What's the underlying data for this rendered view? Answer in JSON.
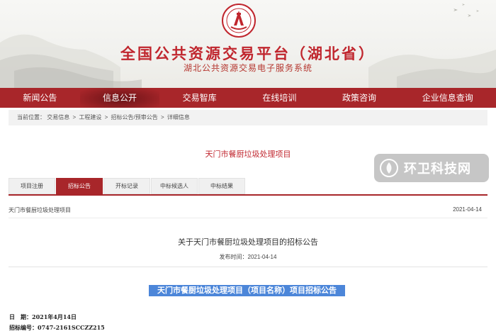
{
  "header": {
    "title": "全国公共资源交易平台（湖北省）",
    "subtitle": "湖北公共资源交易电子服务系统",
    "emblem_icon": "public-resource-emblem",
    "colors": {
      "brand_red": "#a8262a",
      "title_red": "#c0262e"
    }
  },
  "nav": {
    "items": [
      {
        "label": "新闻公告"
      },
      {
        "label": "信息公开"
      },
      {
        "label": "交易智库"
      },
      {
        "label": "在线培训"
      },
      {
        "label": "政策咨询"
      },
      {
        "label": "企业信息查询"
      }
    ],
    "active_index": 1
  },
  "breadcrumb": {
    "prefix": "当前位置：",
    "items": [
      "交易信息",
      "工程建设",
      "招标公告/预审公告",
      "详细信息"
    ],
    "separator": ">"
  },
  "project_title": "天门市餐厨垃圾处理项目",
  "tabs": {
    "items": [
      {
        "label": "项目注册"
      },
      {
        "label": "招标公告"
      },
      {
        "label": "开标记录"
      },
      {
        "label": "中标候选人"
      },
      {
        "label": "中标结果"
      }
    ],
    "active_index": 1
  },
  "list_row": {
    "name": "天门市餐厨垃圾处理项目",
    "date": "2021-04-14"
  },
  "notice": {
    "title": "关于天门市餐厨垃圾处理项目的招标公告",
    "publish_label": "发布时间：2021-04-14",
    "highlight_heading": "天门市餐厨垃圾处理项目（项目名称）项目招标公告",
    "date_line": "日　期：2021年4月14日",
    "code_line": "招标编号：0747-2161SCCZZ215"
  },
  "watermark": {
    "text": "环卫科技网",
    "icon": "watermark-logo-icon"
  }
}
